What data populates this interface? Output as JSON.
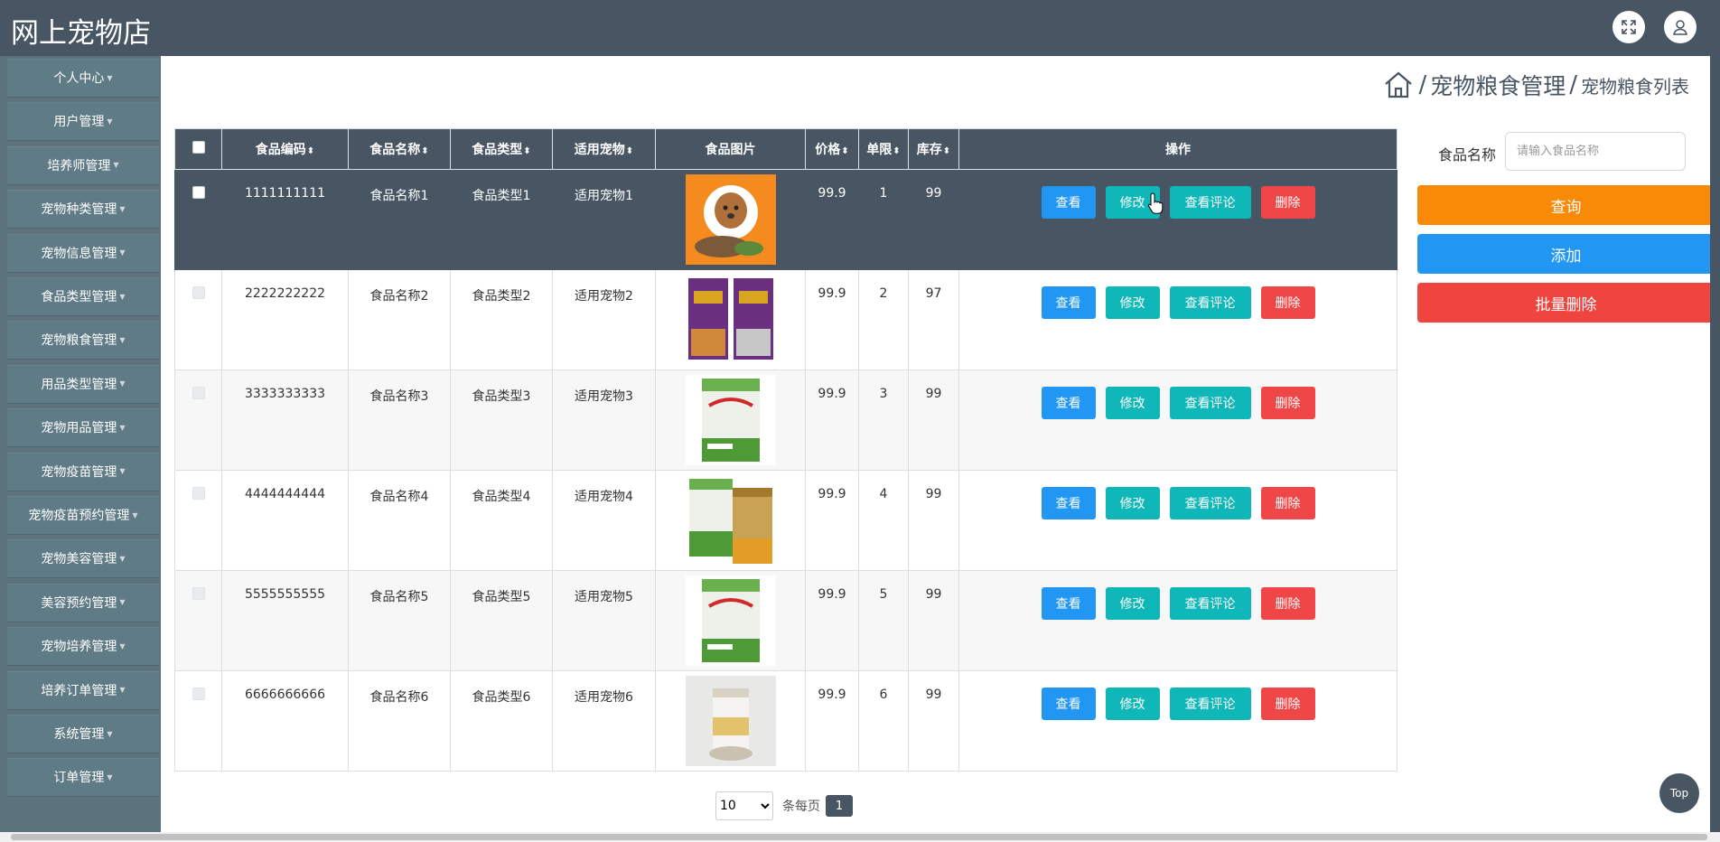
{
  "app": {
    "title": "网上宠物店"
  },
  "sidebar": {
    "items": [
      {
        "label": "个人中心"
      },
      {
        "label": "用户管理"
      },
      {
        "label": "培养师管理"
      },
      {
        "label": "宠物种类管理"
      },
      {
        "label": "宠物信息管理"
      },
      {
        "label": "食品类型管理"
      },
      {
        "label": "宠物粮食管理"
      },
      {
        "label": "用品类型管理"
      },
      {
        "label": "宠物用品管理"
      },
      {
        "label": "宠物疫苗管理"
      },
      {
        "label": "宠物疫苗预约管理"
      },
      {
        "label": "宠物美容管理"
      },
      {
        "label": "美容预约管理"
      },
      {
        "label": "宠物培养管理"
      },
      {
        "label": "培养订单管理"
      },
      {
        "label": "系统管理"
      },
      {
        "label": "订单管理"
      }
    ]
  },
  "breadcrumb": {
    "section": "宠物粮食管理",
    "page": "宠物粮食列表"
  },
  "table": {
    "headers": {
      "code": "食品编码",
      "name": "食品名称",
      "type": "食品类型",
      "pet": "适用宠物",
      "image": "食品图片",
      "price": "价格",
      "limit": "单限",
      "stock": "库存",
      "ops": "操作"
    },
    "rows": [
      {
        "code": "1111111111",
        "name": "食品名称1",
        "type": "食品类型1",
        "pet": "适用宠物1",
        "price": "99.9",
        "limit": "1",
        "stock": "99"
      },
      {
        "code": "2222222222",
        "name": "食品名称2",
        "type": "食品类型2",
        "pet": "适用宠物2",
        "price": "99.9",
        "limit": "2",
        "stock": "97"
      },
      {
        "code": "3333333333",
        "name": "食品名称3",
        "type": "食品类型3",
        "pet": "适用宠物3",
        "price": "99.9",
        "limit": "3",
        "stock": "99"
      },
      {
        "code": "4444444444",
        "name": "食品名称4",
        "type": "食品类型4",
        "pet": "适用宠物4",
        "price": "99.9",
        "limit": "4",
        "stock": "99"
      },
      {
        "code": "5555555555",
        "name": "食品名称5",
        "type": "食品类型5",
        "pet": "适用宠物5",
        "price": "99.9",
        "limit": "5",
        "stock": "99"
      },
      {
        "code": "6666666666",
        "name": "食品名称6",
        "type": "食品类型6",
        "pet": "适用宠物6",
        "price": "99.9",
        "limit": "6",
        "stock": "99"
      }
    ],
    "actions": {
      "view": "查看",
      "edit": "修改",
      "comment": "查看评论",
      "delete": "删除"
    }
  },
  "search": {
    "label": "食品名称",
    "placeholder": "请输入食品名称"
  },
  "buttons": {
    "query": "查询",
    "add": "添加",
    "batch_delete": "批量删除"
  },
  "pagination": {
    "page_size": "10",
    "per_page_label": "条每页",
    "current_page": "1"
  },
  "back_to_top": "Top",
  "colors": {
    "header_bg": "#485563",
    "query": "#f98a08",
    "add": "#2196f3",
    "batch_delete": "#f0443f",
    "view": "#2196f3",
    "edit": "#10b7b8",
    "delete": "#ef4747"
  }
}
